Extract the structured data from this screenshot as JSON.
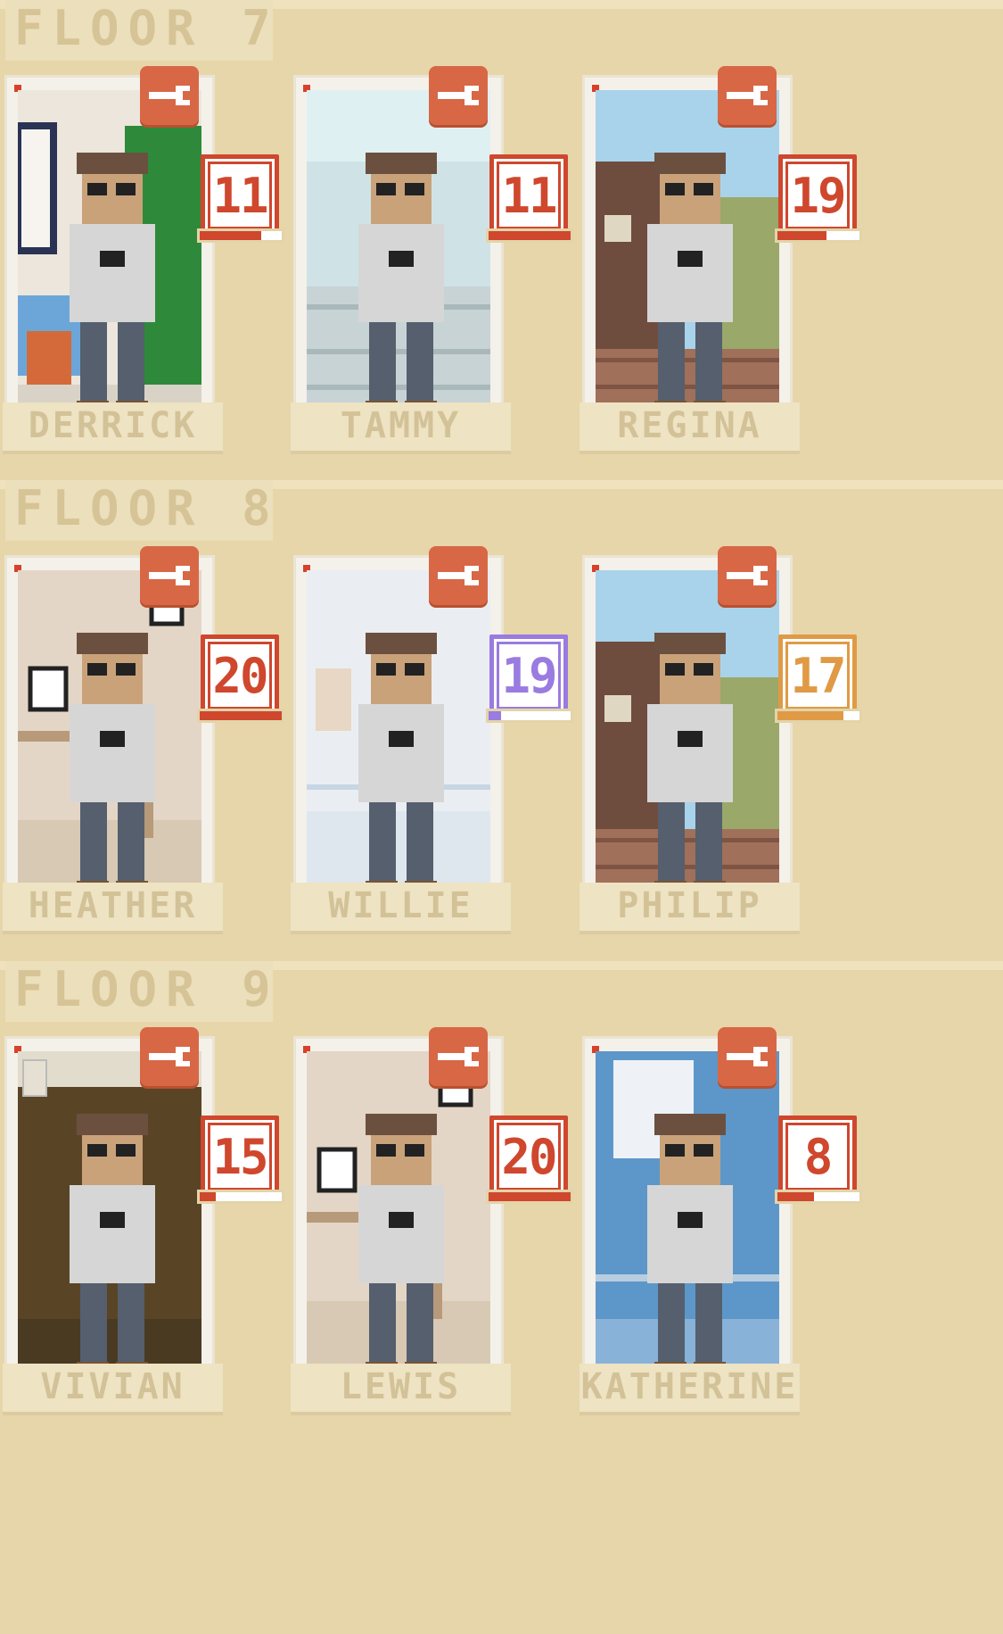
{
  "floors": [
    {
      "label": "FLOOR 7",
      "residents": [
        {
          "name": "DERRICK",
          "level": "11",
          "fill": 0.75,
          "accent": "#cf472d",
          "bg": "santa"
        },
        {
          "name": "TAMMY",
          "level": "11",
          "fill": 1.0,
          "accent": "#cf472d",
          "bg": "lobby"
        },
        {
          "name": "REGINA",
          "level": "19",
          "fill": 0.6,
          "accent": "#cf472d",
          "bg": "outdoor"
        }
      ]
    },
    {
      "label": "FLOOR 8",
      "residents": [
        {
          "name": "HEATHER",
          "level": "20",
          "fill": 1.0,
          "accent": "#cf472d",
          "bg": "office"
        },
        {
          "name": "WILLIE",
          "level": "19",
          "fill": 0.15,
          "accent": "#9a7be0",
          "bg": "clinic"
        },
        {
          "name": "PHILIP",
          "level": "17",
          "fill": 0.8,
          "accent": "#e09a45",
          "bg": "outdoor"
        }
      ]
    },
    {
      "label": "FLOOR 9",
      "residents": [
        {
          "name": "VIVIAN",
          "level": "15",
          "fill": 0.2,
          "accent": "#cf472d",
          "bg": "cabin"
        },
        {
          "name": "LEWIS",
          "level": "20",
          "fill": 1.0,
          "accent": "#cf472d",
          "bg": "office"
        },
        {
          "name": "KATHERINE",
          "level": "8",
          "fill": 0.45,
          "accent": "#cf472d",
          "bg": "lab"
        }
      ]
    }
  ],
  "icons": {
    "remove": "wrench-icon",
    "status": "red-dot-icon"
  }
}
